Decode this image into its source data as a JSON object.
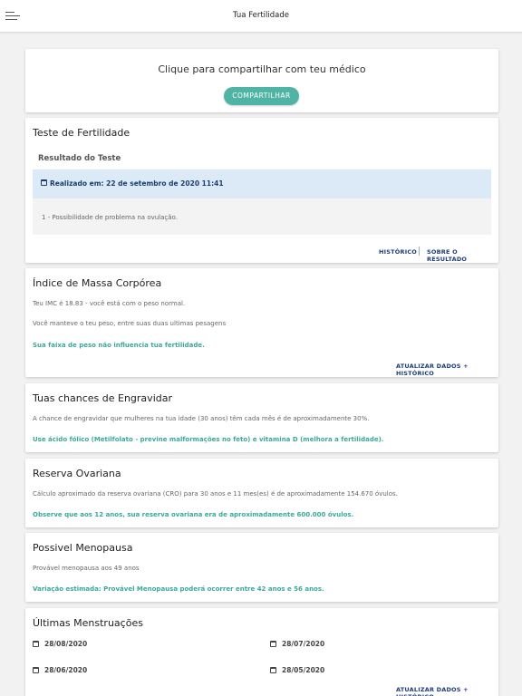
{
  "header": {
    "title": "Tua Fertilidade",
    "menu_icon": "hamburger-menu-icon"
  },
  "share": {
    "text": "Clique para compartilhar com teu médico",
    "button": "COMPARTILHAR"
  },
  "fertility_test": {
    "title": "Teste de Fertilidade",
    "subtitle": "Resultado do Teste",
    "performed": "Realizado em: 22 de setembro de 2020 11:41",
    "result": "1 - Possibilidade de problema na ovulação.",
    "link_history": "HISTÓRICO",
    "link_about": "SOBRE O RESULTADO"
  },
  "bmi": {
    "title": "Índice de Massa Corpórea",
    "line1": "Teu IMC é 18.83 - você está com o peso normal.",
    "line2": "Você manteve o teu peso, entre suas duas ultimas pesagens",
    "note": "Sua faixa de peso não influencia tua fertilidade.",
    "link": "ATUALIZAR DADOS + HISTÓRICO"
  },
  "chances": {
    "title": "Tuas chances de Engravidar",
    "line1": "A chance de engravidar que mulheres na tua idade (30 anos) têm cada mês é de aproximadamente 30%.",
    "note": "Use ácido fólico (Metilfolato - previne malformações no feto) e vitamina D (melhora a fertilidade)."
  },
  "ovarian": {
    "title": "Reserva Ovariana",
    "line1": "Cálculo aproximado da reserva ovariana (CRO) para 30 anos e 11 mes(es) é de aproximadamente 154.670 óvulos.",
    "note": "Observe que aos 12 anos, sua reserva ovariana era de aproximadamente 600.000 óvulos."
  },
  "menopause": {
    "title": "Possivel Menopausa",
    "line1": "Provável menopausa aos 49 anos",
    "note": "Variação estimada: Provável Menopausa poderá ocorrer entre 42 anos e 56 anos."
  },
  "menstruations": {
    "title": "Últimas Menstruações",
    "dates": [
      "28/08/2020",
      "28/07/2020",
      "28/06/2020",
      "28/05/2020"
    ],
    "link": "ATUALIZAR DADOS + HISTÓRICO"
  }
}
